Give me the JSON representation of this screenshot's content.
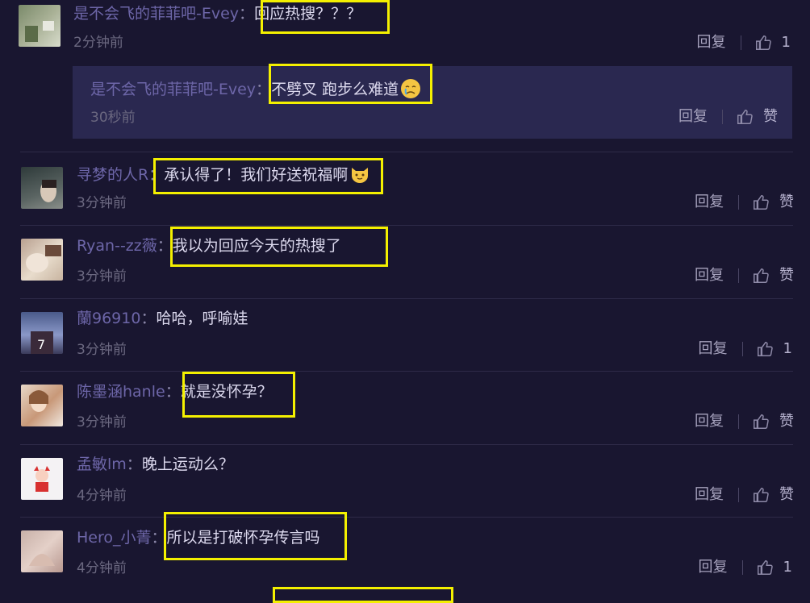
{
  "actions": {
    "reply_label": "回复",
    "like_label": "赞"
  },
  "comments": [
    {
      "user": "是不会飞的菲菲吧-Evey",
      "sep": "：",
      "text": "回应热搜？？？",
      "time": "2分钟前",
      "likes": "1"
    },
    {
      "user": "是不会飞的菲菲吧-Evey",
      "sep": "：",
      "text": "不劈叉  跑步么难道",
      "time": "30秒前",
      "likes": "赞"
    },
    {
      "user": "寻梦的人R",
      "sep": "：",
      "text": "承认得了！我们好送祝福啊",
      "time": "3分钟前",
      "likes": "赞"
    },
    {
      "user": "Ryan--zz薇",
      "sep": "：",
      "text": "我以为回应今天的热搜了",
      "time": "3分钟前",
      "likes": "赞"
    },
    {
      "user": "蘭96910",
      "sep": "：",
      "text": "哈哈，呼喻娃",
      "time": "3分钟前",
      "likes": "1"
    },
    {
      "user": "陈墨涵hanle",
      "sep": "：",
      "text": "就是没怀孕？",
      "time": "3分钟前",
      "likes": "赞"
    },
    {
      "user": "孟敏lm",
      "sep": "：",
      "text": "晚上运动么？",
      "time": "4分钟前",
      "likes": "赞"
    },
    {
      "user": "Hero_小菁",
      "sep": "：",
      "text": "所以是打破怀孕传言吗",
      "time": "4分钟前",
      "likes": "1"
    }
  ],
  "colors": {
    "background": "#191630",
    "reply_box": "#2a2850",
    "highlight": "#f4f000",
    "username": "#6d66a8"
  }
}
